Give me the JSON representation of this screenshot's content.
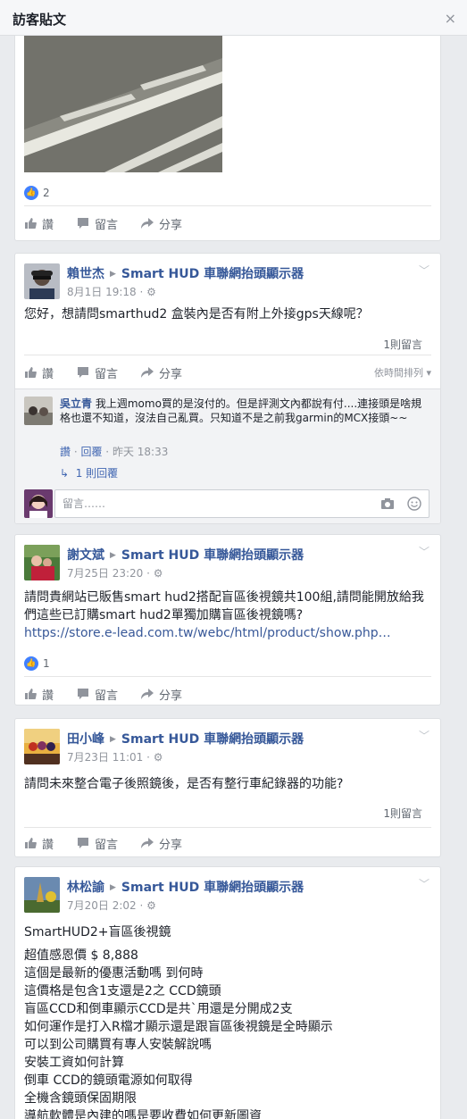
{
  "dialog": {
    "title": "訪客貼文",
    "close": "×"
  },
  "page_name": "Smart HUD 車聯網抬頭顯示器",
  "actions": {
    "like": "讚",
    "comment": "留言",
    "share": "分享"
  },
  "post0": {
    "like_count": "2"
  },
  "post1": {
    "author": "賴世杰",
    "time": "8月1日 19:18",
    "text": "您好，想請問smarthud2 盒裝內是否有附上外接gps天線呢？",
    "comment_count": "1則留言",
    "sort_label": "依時間排列",
    "reply": {
      "name": "吳立青",
      "text": "我上週momo買的是沒付的。但是評測文內都說有付....連接頭是啥規格也還不知道，沒法自己亂買。只知道不是之前我garmin的MCX接頭~~",
      "like": "讚",
      "reply": "回覆",
      "time": "昨天 18:33",
      "more": "1 則回覆"
    },
    "composer_placeholder": "留言……"
  },
  "post2": {
    "author": "謝文斌",
    "time": "7月25日 23:20",
    "text": "請問貴網站已販售smart hud2搭配盲區後視鏡共100組,請問能開放給我們這些已訂購smart hud2單獨加購盲區後視鏡嗎?",
    "link": "https://store.e-lead.com.tw/webc/html/product/show.php…",
    "like_count": "1"
  },
  "post3": {
    "author": "田小峰",
    "time": "7月23日 11:01",
    "text": "請問未來整合電子後照鏡後，是否有整行車紀錄器的功能?",
    "comment_count": "1則留言"
  },
  "post4": {
    "author": "林松諭",
    "time": "7月20日 2:02",
    "heading": "SmartHUD2+盲區後視鏡",
    "lines": [
      "超值感恩價 $ 8,888",
      "這個是最新的優惠活動嗎 到何時",
      "這價格是包含1支還是2之 CCD鏡頭",
      "盲區CCD和倒車顯示CCD是共`用還是分開成2支",
      "如何運作是打入R檔才顯示還是跟盲區後視鏡是全時顯示",
      "可以到公司購買有專人安裝解說嗎",
      "安裝工資如何計算",
      "倒車 CCD的鏡頭電源如何取得",
      "全機含鏡頭保固期限",
      "導航軟體是內建的嗎是要收費如何更新圖資"
    ]
  }
}
